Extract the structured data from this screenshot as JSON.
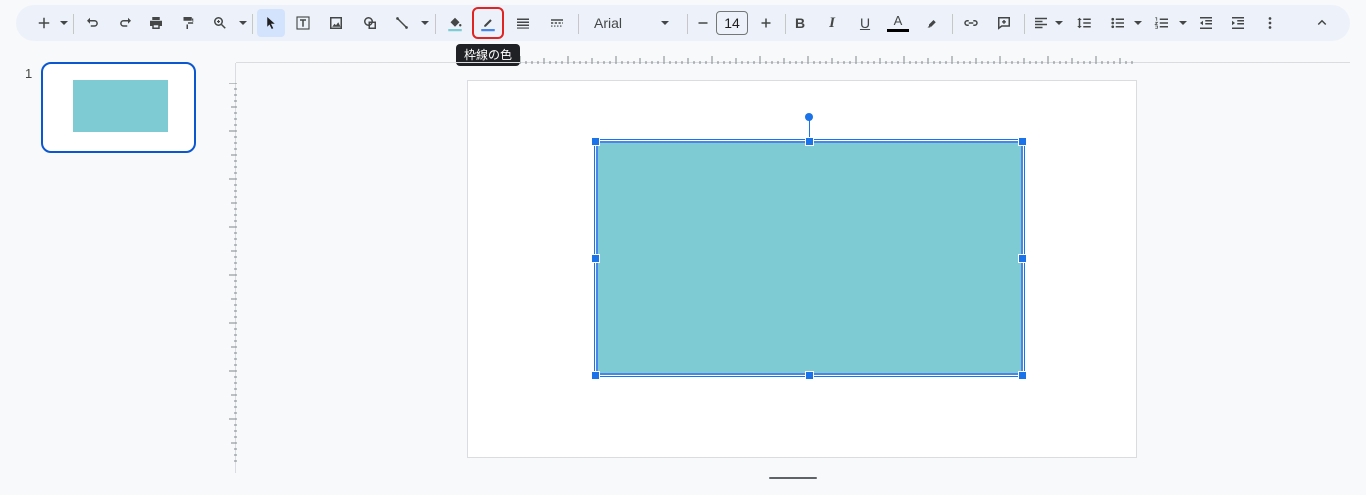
{
  "toolbar": {
    "font_name": "Arial",
    "font_size": "14",
    "tooltip": "枠線の色",
    "bold_label": "B",
    "italic_label": "I",
    "underline_label": "U",
    "text_color_label": "A",
    "fill_color": "#7fcbd4",
    "border_color": "#4a86e8",
    "text_color": "#000000"
  },
  "filmstrip": {
    "slide_number": "1",
    "thumbnail_shape_color": "#7fcbd4"
  },
  "canvas": {
    "shape": {
      "type": "rectangle",
      "fill": "#7fcbd4",
      "border": "#4a86e8"
    }
  },
  "colors": {
    "accent": "#1a73e8",
    "toolbar_bg": "#edf2fa",
    "highlight_box": "#e02424"
  }
}
